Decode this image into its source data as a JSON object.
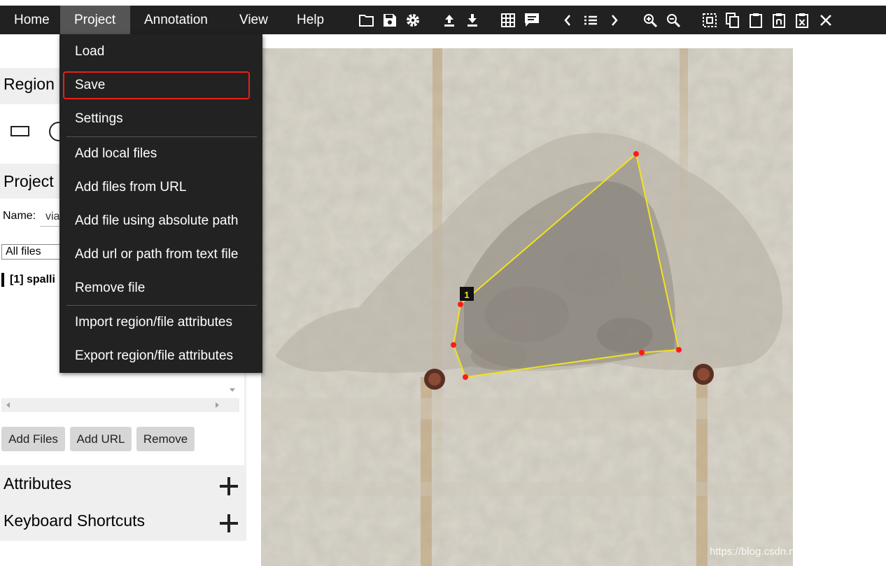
{
  "menubar": {
    "items": [
      {
        "label": "Home"
      },
      {
        "label": "Project"
      },
      {
        "label": "Annotation"
      },
      {
        "label": "View"
      },
      {
        "label": "Help"
      }
    ]
  },
  "toolbar": {
    "icons": [
      "folder-open-icon",
      "save-icon",
      "settings-icon",
      "upload-icon",
      "download-icon",
      "grid-icon",
      "comment-icon",
      "prev-icon",
      "list-icon",
      "next-icon",
      "zoom-in-icon",
      "zoom-out-icon",
      "select-all-icon",
      "copy-icon",
      "paste-icon",
      "paste-n-icon",
      "delete-region-icon",
      "close-icon"
    ]
  },
  "dropdown": {
    "items": [
      {
        "label": "Load"
      },
      {
        "label": "Save"
      },
      {
        "label": "Settings"
      },
      {
        "label": "Add local files"
      },
      {
        "label": "Add files from URL"
      },
      {
        "label": "Add file using absolute path"
      },
      {
        "label": "Add url or path from text file"
      },
      {
        "label": "Remove file"
      },
      {
        "label": "Import region/file attributes"
      },
      {
        "label": "Export region/file attributes"
      }
    ],
    "highlight_color": "#e8201a"
  },
  "sidebar": {
    "region_shape_title": "Region S",
    "project_title": "Project",
    "name_label": "Name:",
    "name_value": "via",
    "filter_value": "All files",
    "file_entry": "[1] spalli",
    "buttons": {
      "add_files": "Add Files",
      "add_url": "Add URL",
      "remove": "Remove"
    },
    "attributes_title": "Attributes",
    "shortcuts_title": "Keyboard Shortcuts"
  },
  "canvas": {
    "region_label": "1",
    "region_color": "#f2e21c",
    "vertex_color": "#ff1a1a"
  },
  "watermark": "https://blog.csdn.net/Fcc_bd_stars"
}
